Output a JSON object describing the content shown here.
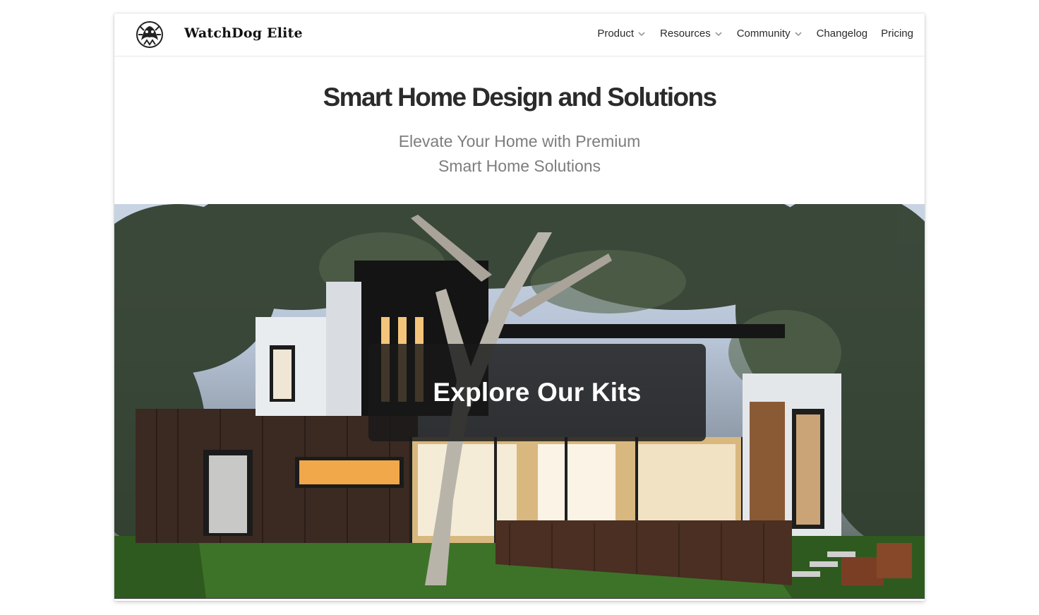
{
  "brand": {
    "name": "WatchDog Elite",
    "logo": "dog-emblem-icon"
  },
  "nav": {
    "items": [
      {
        "label": "Product",
        "has_dropdown": true
      },
      {
        "label": "Resources",
        "has_dropdown": true
      },
      {
        "label": "Community",
        "has_dropdown": true
      },
      {
        "label": "Changelog",
        "has_dropdown": false
      },
      {
        "label": "Pricing",
        "has_dropdown": false
      }
    ]
  },
  "hero": {
    "title": "Smart Home Design and Solutions",
    "subtitle_line1": "Elevate Your Home with Premium",
    "subtitle_line2": "Smart Home Solutions",
    "image": "modern-house-at-dusk-photo",
    "cta_label": "Explore Our Kits"
  },
  "colors": {
    "title": "#2b2b2b",
    "subtitle": "#7d7d7d",
    "cta_background": "#191919",
    "cta_text": "#ffffff"
  }
}
